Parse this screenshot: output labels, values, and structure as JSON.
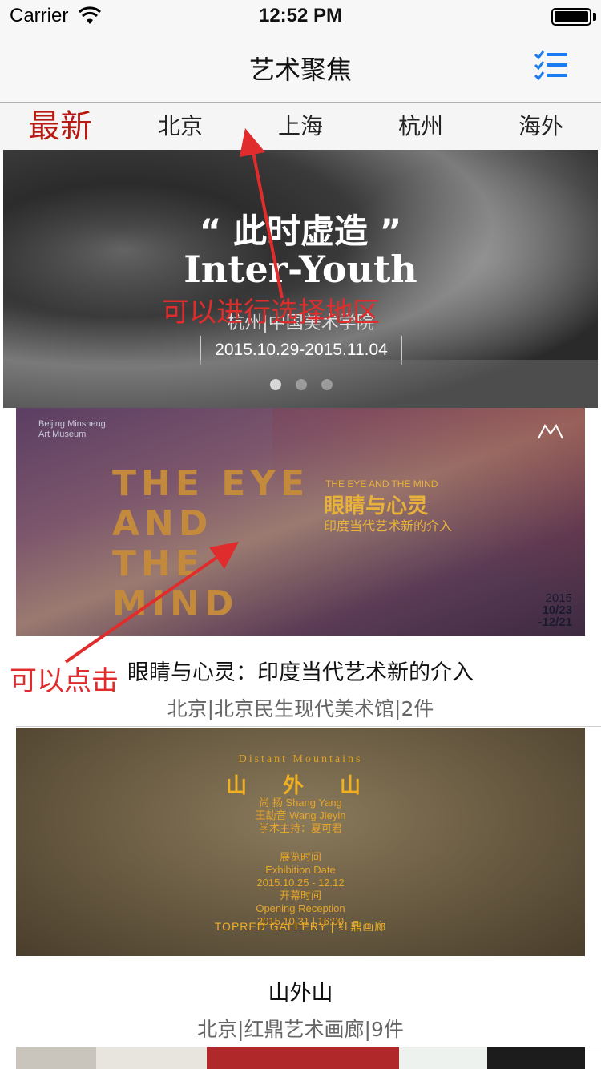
{
  "status_bar": {
    "carrier": "Carrier",
    "time": "12:52 PM"
  },
  "nav": {
    "title": "艺术聚焦",
    "menu_icon": "list-checks-icon"
  },
  "tabs": [
    {
      "label": "最新",
      "active": true
    },
    {
      "label": "北京",
      "active": false
    },
    {
      "label": "上海",
      "active": false
    },
    {
      "label": "杭州",
      "active": false
    },
    {
      "label": "海外",
      "active": false
    }
  ],
  "banner": {
    "title_cn": "“ 此时虚造 ”",
    "title_en": "Inter-Youth",
    "venue": "杭州|中国美术学院",
    "dates": "2015.10.29-2015.11.04",
    "page_count": 3,
    "current_page": 1
  },
  "exhibitions": [
    {
      "title": "眼睛与心灵：印度当代艺术新的介入",
      "meta": "北京|北京民生现代美术馆|2件",
      "poster": {
        "museum": "Beijing Minsheng Art Museum",
        "big_text": "THE EYE AND THE MIND",
        "en_title": "THE EYE AND THE MIND",
        "cn_title": "眼睛与心灵",
        "cn_subtitle": "印度当代艺术新的介入",
        "date_year": "2015",
        "date_range": "10/23 -12/21"
      }
    },
    {
      "title": "山外山",
      "meta": "北京|红鼎艺术画廊|9件",
      "poster": {
        "en_title": "Distant Mountains",
        "cn_title": "山 外 山",
        "lines": [
          "尚 扬 Shang Yang",
          "王劼音 Wang Jieyin",
          "学术主持：夏可君",
          "展览时间",
          "Exhibition Date",
          "2015.10.25 - 12.12",
          "开幕时间",
          "Opening Reception",
          "2015.10.31 | 16:00"
        ],
        "gallery": "TOPRED GALLERY | 红鼎画廊"
      }
    }
  ],
  "annotations": {
    "region_hint": "可以进行选择地区",
    "click_hint": "可以点击"
  },
  "colors": {
    "accent_red": "#b71a12",
    "annotation_red": "#e02c2c",
    "ios_blue": "#1a7cf0"
  }
}
